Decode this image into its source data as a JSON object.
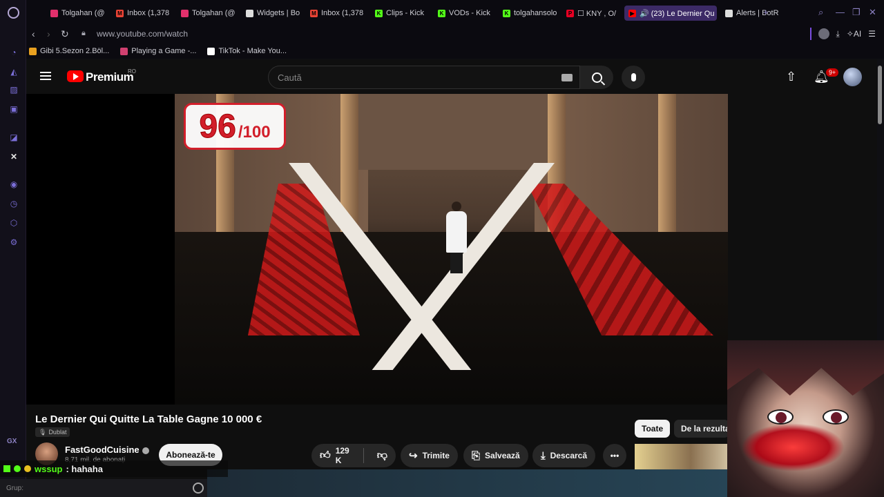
{
  "browser": {
    "tabs": [
      {
        "label": "Tolgahan (@",
        "color": "#e1306c",
        "glyph": ""
      },
      {
        "label": "Inbox (1,378",
        "color": "#ea4335",
        "glyph": "M"
      },
      {
        "label": "Tolgahan (@",
        "color": "#e1306c",
        "glyph": ""
      },
      {
        "label": "Widgets | Bo",
        "color": "#dddddd",
        "glyph": ""
      },
      {
        "label": "Inbox (1,378",
        "color": "#ea4335",
        "glyph": "M"
      },
      {
        "label": "Clips - Kick",
        "color": "#53fc18",
        "glyph": "K"
      },
      {
        "label": "VODs - Kick",
        "color": "#53fc18",
        "glyph": "K"
      },
      {
        "label": "tolgahansolo",
        "color": "#53fc18",
        "glyph": "K"
      },
      {
        "label": "☐ KNY , O/",
        "color": "#e60023",
        "glyph": "P"
      },
      {
        "label": "🔊 (23) Le Dernier Qu",
        "color": "#ff0000",
        "glyph": "▶"
      },
      {
        "label": "Alerts | BotR",
        "color": "#dddddd",
        "glyph": ""
      }
    ],
    "new_tab": "+",
    "url": "www.youtube.com/watch",
    "ai_label": "AI",
    "bookmarks": [
      {
        "label": "Gibi 5.Sezon 2.Böl...",
        "color": "#e8a020"
      },
      {
        "label": "Playing a Game -...",
        "color": "#d04070"
      },
      {
        "label": "TikTok - Make You...",
        "color": "#ffffff"
      }
    ],
    "gx_label": "GX"
  },
  "youtube": {
    "brand": "Premium",
    "region": "RO",
    "search_placeholder": "Caută",
    "notifications": "9+",
    "video": {
      "score_value": "96",
      "score_total": "/100"
    },
    "title": "Le Dernier Qui Quitte La Table Gagne 10 000 €",
    "dub_label": "Dublat",
    "channel": {
      "name": "FastGoodCuisine",
      "subscribers": "8,71 mil. de abonați",
      "subscribe_label": "Abonează-te"
    },
    "actions": {
      "likes": "129 K",
      "share": "Trimite",
      "save": "Salvează",
      "download": "Descarcă",
      "more": "•••"
    },
    "chips": {
      "all": "Toate",
      "related": "De la rezultat"
    }
  },
  "overlay": {
    "chat_user": "wssup",
    "chat_message": ": hahaha",
    "grup_label": "Grup:"
  }
}
